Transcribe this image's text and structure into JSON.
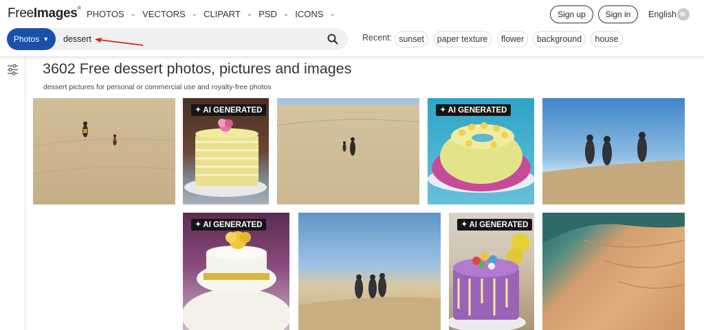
{
  "header": {
    "logo": {
      "part1": "Free",
      "part2": "Images",
      "mark": "®"
    },
    "nav": [
      "PHOTOS",
      "VECTORS",
      "CLIPART",
      "PSD",
      "ICONS"
    ],
    "signup_label": "Sign up",
    "signin_label": "Sign in",
    "language_label": "English"
  },
  "search": {
    "type_label": "Photos",
    "query": "dessert",
    "recent_label": "Recent:",
    "recent": [
      "sunset",
      "paper texture",
      "flower",
      "background",
      "house"
    ]
  },
  "main": {
    "title": "3602 Free dessert photos, pictures and images",
    "subtitle": "dessert pictures for personal or commercial use and royalty-free photos",
    "ai_badge_label": "AI GENERATED"
  },
  "colors": {
    "accent": "#1a50ad",
    "annotation_arrow": "#e01e1e",
    "badge_bg": "#151515"
  },
  "icons": [
    "search-icon",
    "chevron-down-icon",
    "globe-icon",
    "filter-sliders-icon",
    "sparkle-icon"
  ]
}
